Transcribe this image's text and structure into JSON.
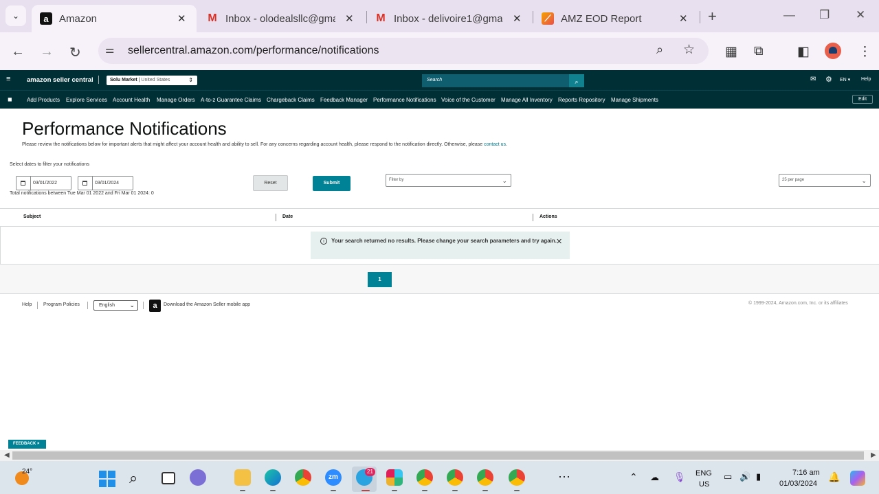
{
  "browser": {
    "tabs": [
      {
        "title": "Amazon",
        "active": true
      },
      {
        "title": "Inbox - olodealsllc@gmail",
        "active": false
      },
      {
        "title": "Inbox - delivoire1@gmail",
        "active": false
      },
      {
        "title": "AMZ EOD Report",
        "active": false
      }
    ],
    "new_tab": "+",
    "url": "sellercentral.amazon.com/performance/notifications"
  },
  "sc_header": {
    "brand": "amazon seller central",
    "store_name": "Solu Market",
    "store_region": "United States",
    "search_placeholder": "Search",
    "language": "EN",
    "help": "Help"
  },
  "nav": {
    "items": [
      "Add Products",
      "Explore Services",
      "Account Health",
      "Manage Orders",
      "A-to-z Guarantee Claims",
      "Chargeback Claims",
      "Feedback Manager",
      "Performance Notifications",
      "Voice of the Customer",
      "Manage All Inventory",
      "Reports Repository",
      "Manage Shipments"
    ],
    "edit": "Edit"
  },
  "page": {
    "title": "Performance Notifications",
    "description": "Please review the notifications below for important alerts that might affect your account health and ability to sell. For any concerns regarding account health, please respond to the notification directly. Otherwise, please ",
    "contact_link": "contact us",
    "description_end": ".",
    "filter_label": "Select dates to filter your notifications",
    "date_from": "03/01/2022",
    "date_to": "03/01/2024",
    "reset": "Reset",
    "submit": "Submit",
    "filter_by_placeholder": "Filter by",
    "per_page": "25 per page",
    "total_text": "Total notifications between Tue Mar 01 2022 and Fri Mar 01 2024: 0"
  },
  "table": {
    "columns": [
      "Subject",
      "Date",
      "Actions"
    ],
    "alert": "Your search returned no results. Please change your search parameters and try again."
  },
  "pagination": {
    "current": "1"
  },
  "footer": {
    "help": "Help",
    "policies": "Program Policies",
    "language": "English",
    "app_text": "Download the Amazon Seller mobile app",
    "copyright": "© 1999-2024, Amazon.com, Inc. or its affiliates"
  },
  "feedback": "FEEDBACK ×",
  "taskbar": {
    "temperature": "24°",
    "telegram_badge": "21",
    "lang_top": "ENG",
    "lang_bottom": "US",
    "time": "7:16 am",
    "date": "01/03/2024"
  }
}
